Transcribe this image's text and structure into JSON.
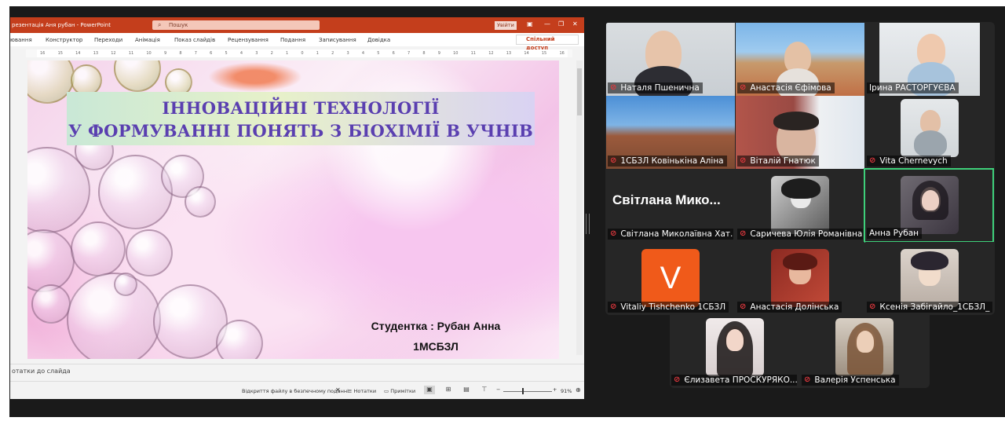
{
  "powerpoint": {
    "title": "резентація Аня рубан  -  PowerPoint",
    "search_placeholder": "Пошук",
    "signin_label": "Увійти",
    "ribbon_tabs": [
      "ювання",
      "Конструктор",
      "Переходи",
      "Анімація",
      "Показ слайдів",
      "Рецензування",
      "Подання",
      "Записування",
      "Довідка"
    ],
    "share_label": "Спільний доступ",
    "ruler_ticks": [
      "16",
      "15",
      "14",
      "13",
      "12",
      "11",
      "10",
      "9",
      "8",
      "7",
      "6",
      "5",
      "4",
      "3",
      "2",
      "1",
      "0",
      "1",
      "2",
      "3",
      "4",
      "5",
      "6",
      "7",
      "8",
      "9",
      "10",
      "11",
      "12",
      "13",
      "14",
      "15",
      "16"
    ],
    "slide": {
      "title_line1": "ІННОВАЦІЙНІ ТЕХНОЛОГІЇ",
      "title_line2": "У ФОРМУВАННІ ПОНЯТЬ З БІОХІМІЇ В УЧНІВ",
      "student_line1": "Студентка : Рубан Анна",
      "student_line2": "1МСБЗЛ"
    },
    "notes_label": "отатки до слайда",
    "status": {
      "protected_view": "Відкриття файлу в безпечному поданні",
      "notes_button": "Нотатки",
      "comments_button": "Примітки",
      "zoom_minus": "−",
      "zoom_plus": "+",
      "zoom_level": "91%"
    }
  },
  "zoom_gallery": {
    "accent_color": "#3ed07a",
    "participants": [
      {
        "name": "Наталя Пшенична",
        "muted": true
      },
      {
        "name": "Анастасія Єфімова",
        "muted": true
      },
      {
        "name": "Ірина РАСТОРГУЄВА",
        "muted": false
      },
      {
        "name": "1СБЗЛ Ковінькіна Аліна",
        "muted": true
      },
      {
        "name": "Віталій Гнатюк",
        "muted": true
      },
      {
        "name": "Vita Chernevych",
        "muted": true
      },
      {
        "name": "Світлана Миколаївна Хат...",
        "muted": true,
        "display_label": "Світлана Мико..."
      },
      {
        "name": "Саричева Юлія Романівна",
        "muted": true
      },
      {
        "name": "Анна Рубан",
        "muted": false,
        "active_speaker": true
      },
      {
        "name": "Vitaliy Tishchenko 1СБЗЛ",
        "muted": true,
        "avatar_letter": "V"
      },
      {
        "name": "Анастасія Долінська",
        "muted": true
      },
      {
        "name": "Ксенія Забігайло_1СБЗЛ_",
        "muted": true
      },
      {
        "name": "Єлизавета ПРОСКУРЯКО...",
        "muted": true
      },
      {
        "name": "Валерія Успенська",
        "muted": true
      }
    ]
  }
}
